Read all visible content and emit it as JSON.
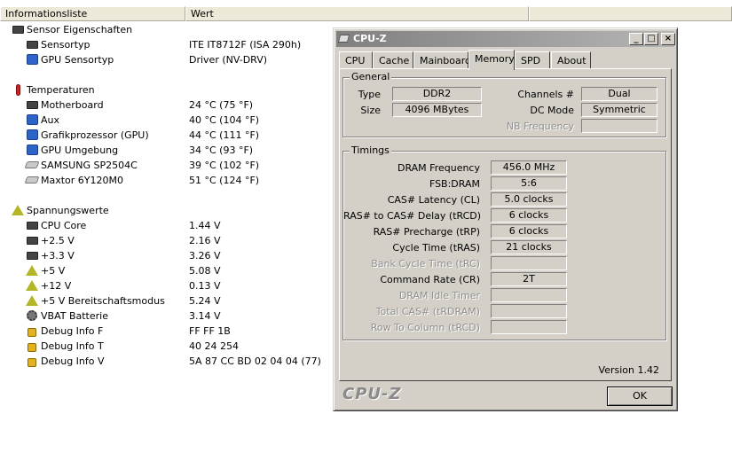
{
  "list": {
    "columns": [
      "Informationsliste",
      "Wert"
    ],
    "rows": [
      {
        "type": "group",
        "label": "Sensor Eigenschaften",
        "icon": "chip-icon"
      },
      {
        "type": "item",
        "label": "Sensortyp",
        "value": "ITE IT8712F  (ISA 290h)",
        "icon": "chip-icon"
      },
      {
        "type": "item",
        "label": "GPU Sensortyp",
        "value": "Driver  (NV-DRV)",
        "icon": "monitor-icon"
      },
      {
        "type": "group",
        "label": "Temperaturen",
        "icon": "thermometer-icon"
      },
      {
        "type": "item",
        "label": "Motherboard",
        "value": "24 °C  (75 °F)",
        "icon": "chip-icon"
      },
      {
        "type": "item",
        "label": "Aux",
        "value": "40 °C  (104 °F)",
        "icon": "monitor-icon"
      },
      {
        "type": "item",
        "label": "Grafikprozessor (GPU)",
        "value": "44 °C  (111 °F)",
        "icon": "monitor-icon"
      },
      {
        "type": "item",
        "label": "GPU Umgebung",
        "value": "34 °C  (93 °F)",
        "icon": "monitor-icon"
      },
      {
        "type": "item",
        "label": "SAMSUNG SP2504C",
        "value": "39 °C  (102 °F)",
        "icon": "hdd-icon"
      },
      {
        "type": "item",
        "label": "Maxtor 6Y120M0",
        "value": "51 °C  (124 °F)",
        "icon": "hdd-icon"
      },
      {
        "type": "group",
        "label": "Spannungswerte",
        "icon": "warning-icon"
      },
      {
        "type": "item",
        "label": "CPU Core",
        "value": "1.44 V",
        "icon": "chip-icon"
      },
      {
        "type": "item",
        "label": "+2.5 V",
        "value": "2.16 V",
        "icon": "chip-icon"
      },
      {
        "type": "item",
        "label": "+3.3 V",
        "value": "3.26 V",
        "icon": "chip-icon"
      },
      {
        "type": "item",
        "label": "+5 V",
        "value": "5.08 V",
        "icon": "warning-icon"
      },
      {
        "type": "item",
        "label": "+12 V",
        "value": "0.13 V",
        "icon": "warning-icon"
      },
      {
        "type": "item",
        "label": "+5 V Bereitschaftsmodus",
        "value": "5.24 V",
        "icon": "warning-icon"
      },
      {
        "type": "item",
        "label": "VBAT Batterie",
        "value": "3.14 V",
        "icon": "gear-icon"
      },
      {
        "type": "item",
        "label": "Debug Info F",
        "value": "FF FF 1B",
        "icon": "lock-icon"
      },
      {
        "type": "item",
        "label": "Debug Info T",
        "value": "40 24 254",
        "icon": "lock-icon"
      },
      {
        "type": "item",
        "label": "Debug Info V",
        "value": "5A 87 CC BD 02 04 04 (77)",
        "icon": "lock-icon"
      }
    ]
  },
  "cpuz": {
    "title": "CPU-Z",
    "title_buttons": [
      "_",
      "□",
      "×"
    ],
    "tabs": [
      "CPU",
      "Cache",
      "Mainboard",
      "Memory",
      "SPD",
      "About"
    ],
    "active_tab": "Memory",
    "general": {
      "title": "General",
      "type_label": "Type",
      "type_value": "DDR2",
      "size_label": "Size",
      "size_value": "4096 MBytes",
      "channels_label": "Channels #",
      "channels_value": "Dual",
      "dcmode_label": "DC Mode",
      "dcmode_value": "Symmetric",
      "nbfreq_label": "NB Frequency",
      "nbfreq_value": ""
    },
    "timings": {
      "title": "Timings",
      "rows": [
        {
          "label": "DRAM Frequency",
          "value": "456.0 MHz",
          "enabled": true
        },
        {
          "label": "FSB:DRAM",
          "value": "5:6",
          "enabled": true
        },
        {
          "label": "CAS# Latency (CL)",
          "value": "5.0 clocks",
          "enabled": true
        },
        {
          "label": "RAS# to CAS# Delay (tRCD)",
          "value": "6 clocks",
          "enabled": true
        },
        {
          "label": "RAS# Precharge (tRP)",
          "value": "6 clocks",
          "enabled": true
        },
        {
          "label": "Cycle Time (tRAS)",
          "value": "21 clocks",
          "enabled": true
        },
        {
          "label": "Bank Cycle Time (tRC)",
          "value": "",
          "enabled": false
        },
        {
          "label": "Command Rate (CR)",
          "value": "2T",
          "enabled": true
        },
        {
          "label": "DRAM Idle Timer",
          "value": "",
          "enabled": false
        },
        {
          "label": "Total CAS# (tRDRAM)",
          "value": "",
          "enabled": false
        },
        {
          "label": "Row To Column (tRCD)",
          "value": "",
          "enabled": false
        }
      ]
    },
    "version": "Version 1.42",
    "brand": "CPU-Z",
    "ok_label": "OK"
  },
  "colors": {
    "window_bg": "#d4d0c8",
    "titlebar_inactive": "#808080",
    "disabled_text": "#8f8f8f"
  }
}
